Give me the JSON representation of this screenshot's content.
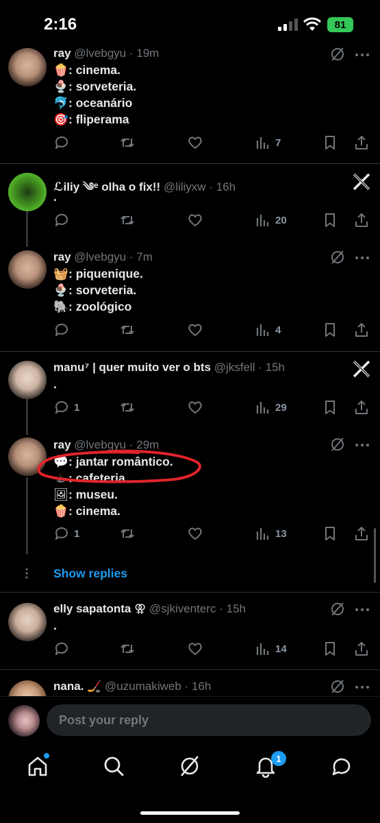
{
  "status_bar": {
    "time": "2:16",
    "battery": "81"
  },
  "tweets": [
    {
      "name": "ray",
      "handle": "@lvebgyu",
      "time": "19m",
      "lines": [
        {
          "emoji": "🍿",
          "text": ": cinema."
        },
        {
          "emoji": "🍨",
          "text": ": sorveteria."
        },
        {
          "emoji": "🐬",
          "text": ": oceanário"
        },
        {
          "emoji": "🎯",
          "text": ": fliperama"
        }
      ],
      "views": "7"
    },
    {
      "name": "ℒiliy ༄ᵉ olha o fix!!",
      "handle": "@liliyxw",
      "time": "16h",
      "lines": [
        {
          "emoji": "",
          "text": "."
        }
      ],
      "views": "20"
    },
    {
      "name": "ray",
      "handle": "@lvebgyu",
      "time": "7m",
      "lines": [
        {
          "emoji": "🧺",
          "text": ": piquenique."
        },
        {
          "emoji": "🍨",
          "text": ": sorveteria."
        },
        {
          "emoji": "🐘",
          "text": ": zoológico"
        }
      ],
      "views": "4"
    },
    {
      "name": "manu⁷ | quer muito ver o bts",
      "handle": "@jksfell",
      "time": "15h",
      "lines": [
        {
          "emoji": "",
          "text": "."
        }
      ],
      "replies": "1",
      "views": "29"
    },
    {
      "name": "ray",
      "handle": "@lvebgyu",
      "time": "29m",
      "lines": [
        {
          "emoji": "💬",
          "text": ": jantar romântico."
        },
        {
          "emoji": "☕",
          "text": ": cafeteria."
        },
        {
          "emoji": "🖼",
          "text": ": museu."
        },
        {
          "emoji": "🍿",
          "text": ": cinema."
        }
      ],
      "replies": "1",
      "views": "13"
    },
    {
      "name": "elly sapatonta ⚢",
      "handle": "@sjkiventerc",
      "time": "15h",
      "lines": [
        {
          "emoji": "",
          "text": "."
        }
      ],
      "views": "14"
    },
    {
      "name": "nana. 🏒",
      "handle": "@uzumakiweb",
      "time": "16h"
    }
  ],
  "show_replies": "Show replies",
  "reply": {
    "placeholder": "Post your reply"
  },
  "tabbar": {
    "notifications_badge": "1"
  },
  "colors": {
    "accent": "#1d9bf0",
    "annotation": "#e0242b",
    "battery": "#33c75a"
  }
}
